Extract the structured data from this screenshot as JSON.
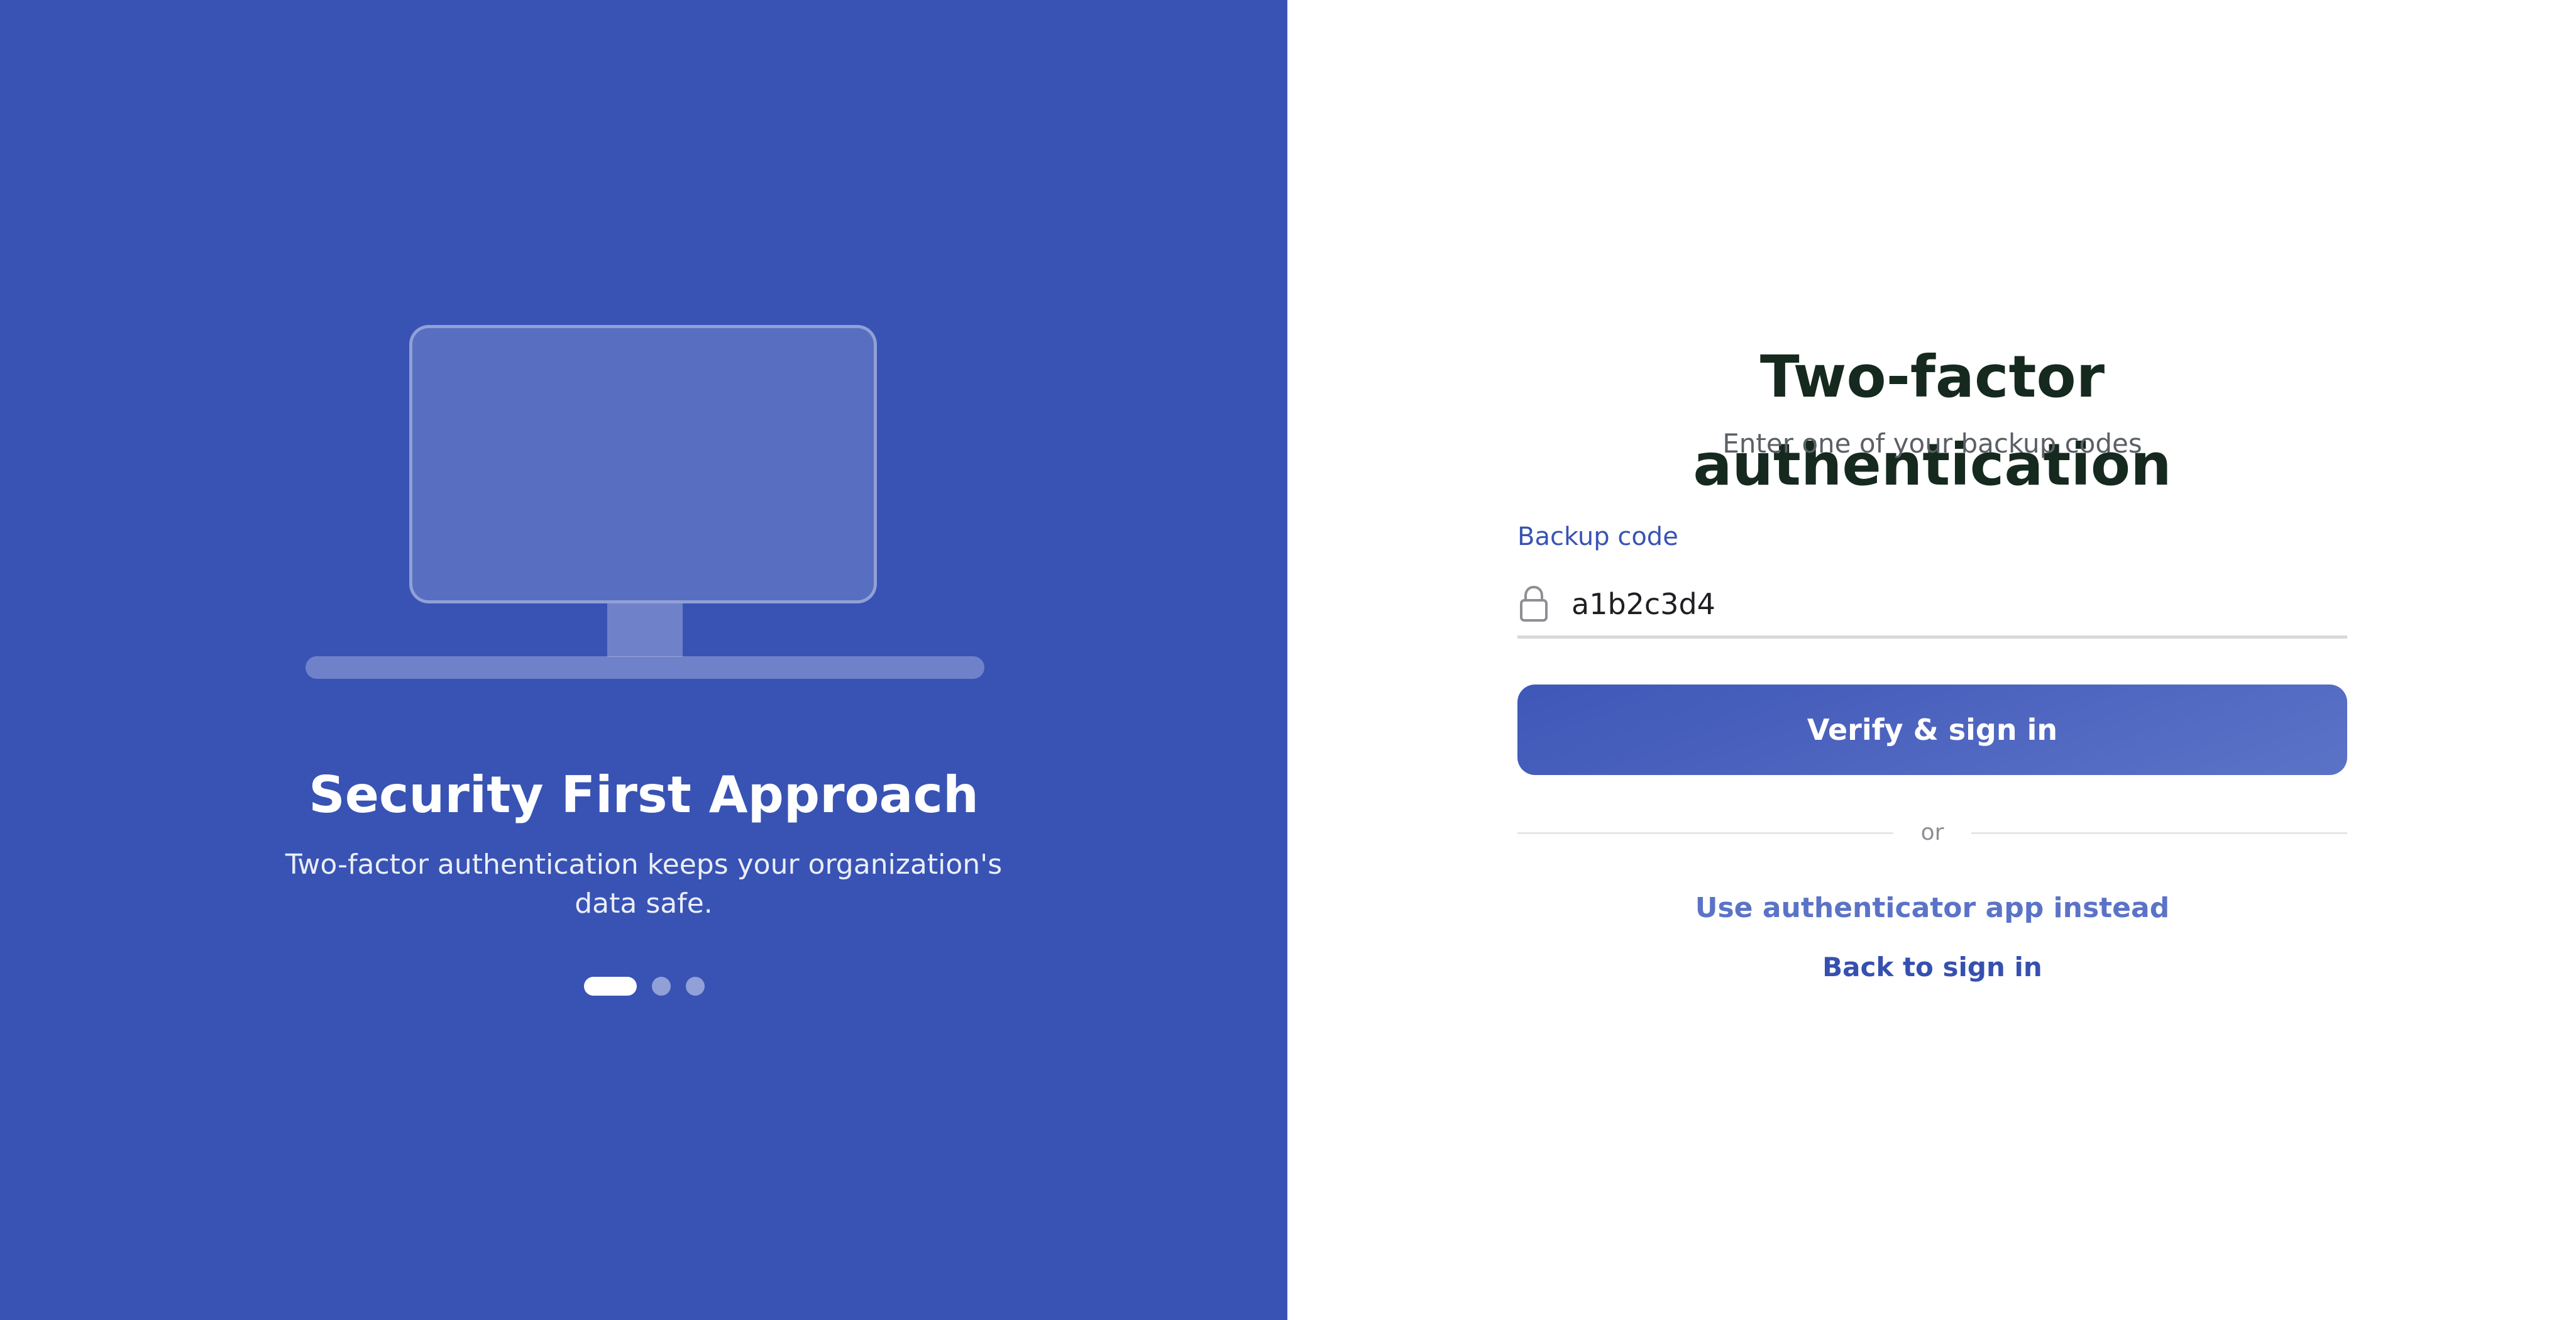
{
  "promo": {
    "title": "Security First Approach",
    "description": "Two-factor authentication keeps your organization's data safe.",
    "carousel": {
      "total_slides": 3,
      "active_slide": 1
    },
    "background_color": "#3853b4",
    "illustration_icon": "monitor-icon"
  },
  "form": {
    "title": "Two-factor authentication",
    "subtitle": "Enter one of your backup codes",
    "backup_code": {
      "label": "Backup code",
      "value": "a1b2c3d4",
      "icon": "lock-icon"
    },
    "verify_button_label": "Verify & sign in",
    "divider_text": "or",
    "authenticator_link": "Use authenticator app instead",
    "back_link": "Back to sign in"
  },
  "colors": {
    "primary": "#3853b4",
    "title_text": "#15291f",
    "muted_text": "#5b5f66"
  }
}
